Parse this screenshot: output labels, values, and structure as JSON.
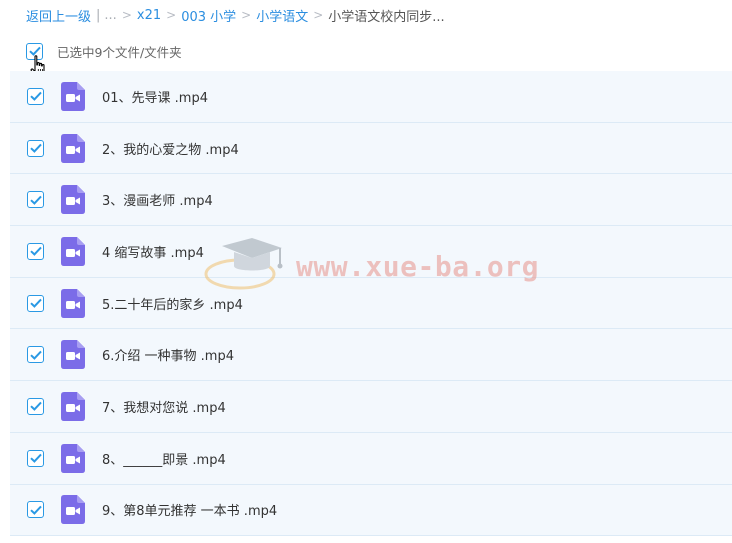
{
  "breadcrumb": {
    "back": "返回上一级",
    "pipe": "|",
    "ellipsis": "...",
    "sep": ">",
    "items": [
      "x21",
      "003 小学",
      "小学语文"
    ],
    "current": "小学语文校内同步..."
  },
  "selection": {
    "label": "已选中9个文件/文件夹"
  },
  "watermark": {
    "text": "www.xue-ba.org"
  },
  "colors": {
    "accent": "#2a99e4",
    "link": "#2b8ee0",
    "row_bg": "#f3f8fd",
    "video_icon": "#7b6ce8"
  },
  "files": [
    {
      "name": "01、先导课 .mp4",
      "icon": "video-file-icon",
      "checked": true
    },
    {
      "name": "2、我的心爱之物 .mp4",
      "icon": "video-file-icon",
      "checked": true
    },
    {
      "name": "3、漫画老师 .mp4",
      "icon": "video-file-icon",
      "checked": true
    },
    {
      "name": "4 缩写故事 .mp4",
      "icon": "video-file-icon",
      "checked": true
    },
    {
      "name": "5.二十年后的家乡 .mp4",
      "icon": "video-file-icon",
      "checked": true
    },
    {
      "name": "6.介绍 一种事物 .mp4",
      "icon": "video-file-icon",
      "checked": true
    },
    {
      "name": "7、我想对您说 .mp4",
      "icon": "video-file-icon",
      "checked": true
    },
    {
      "name": "8、______即景 .mp4",
      "icon": "video-file-icon",
      "checked": true
    },
    {
      "name": "9、第8单元推荐 一本书 .mp4",
      "icon": "video-file-icon",
      "checked": true
    }
  ]
}
